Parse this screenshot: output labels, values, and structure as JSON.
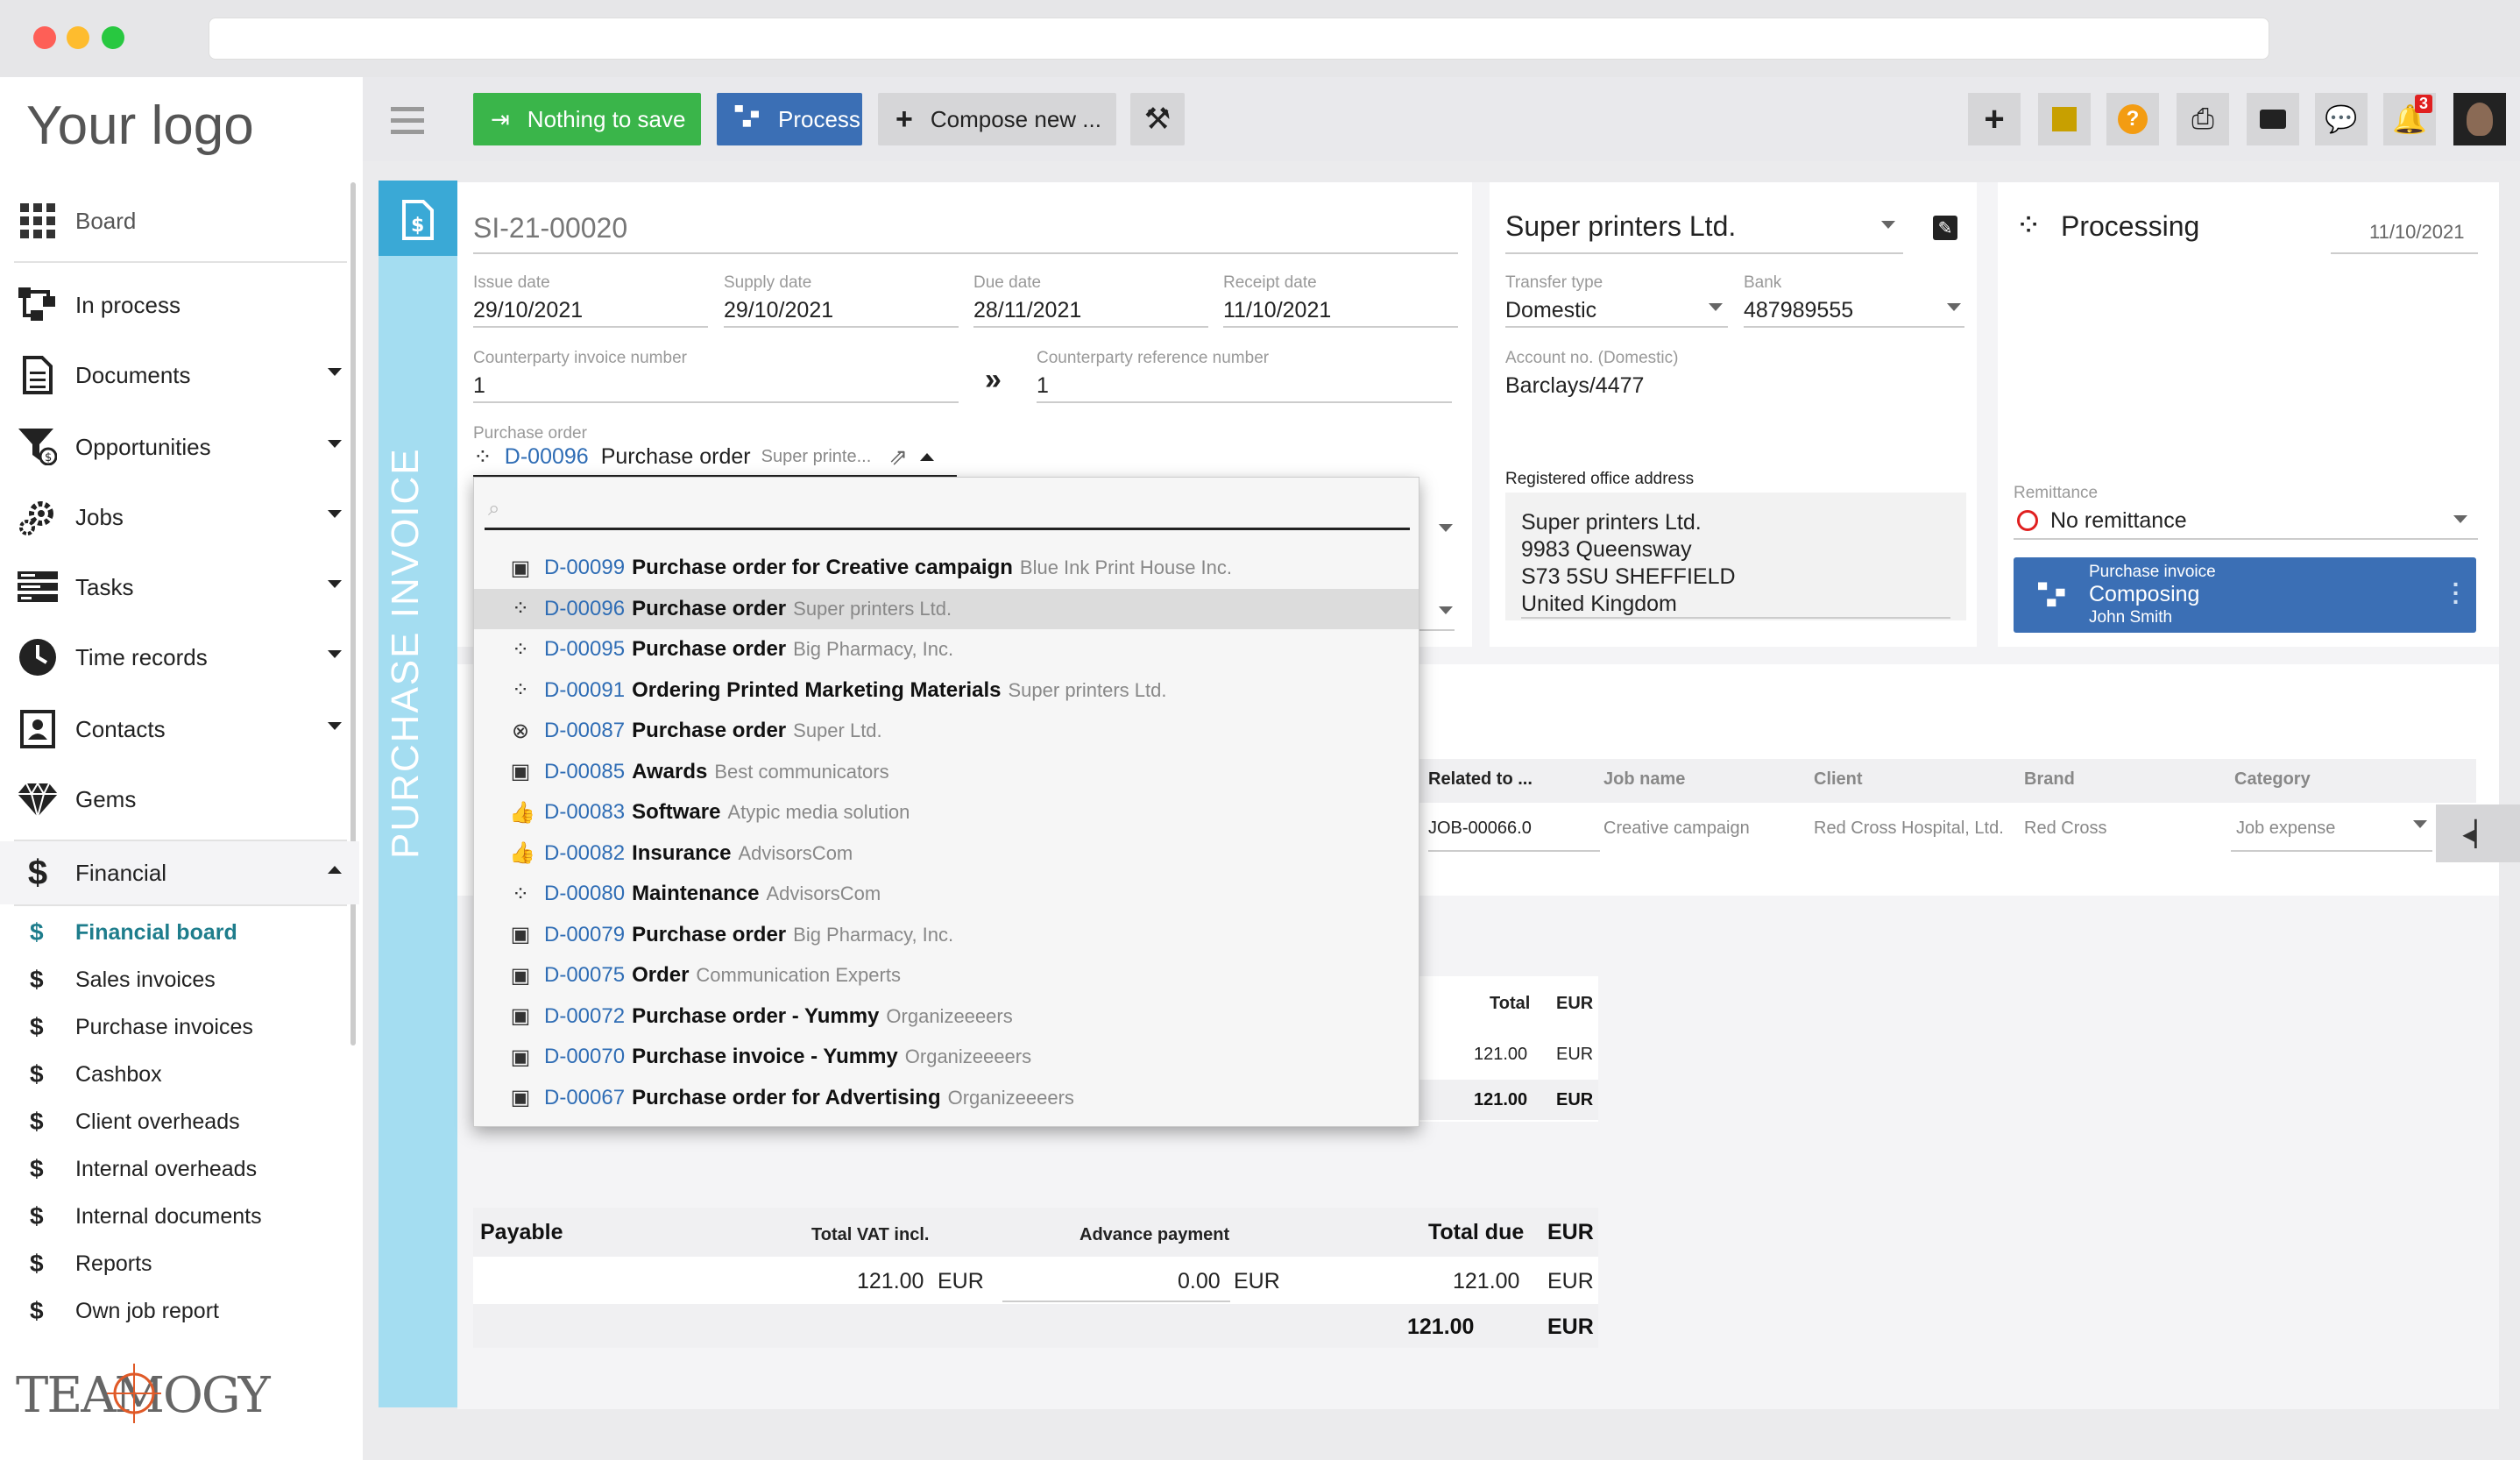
{
  "app": {
    "logo": "Your logo",
    "brand": "TEAMOGY"
  },
  "toolbar": {
    "nothing_to_save": "Nothing to save",
    "process": "Process",
    "compose": "Compose new ...",
    "notif_count": "3"
  },
  "sidebar": {
    "items": [
      {
        "label": "Board",
        "icon": "grid-icon"
      },
      {
        "label": "In process",
        "icon": "flow-icon"
      },
      {
        "label": "Documents",
        "icon": "document-icon"
      },
      {
        "label": "Opportunities",
        "icon": "funnel-icon"
      },
      {
        "label": "Jobs",
        "icon": "gear-icon"
      },
      {
        "label": "Tasks",
        "icon": "tasks-icon"
      },
      {
        "label": "Time records",
        "icon": "clock-icon"
      },
      {
        "label": "Contacts",
        "icon": "contact-icon"
      },
      {
        "label": "Gems",
        "icon": "gem-icon"
      },
      {
        "label": "Financial",
        "icon": "dollar-icon"
      }
    ],
    "sub": [
      "Financial board",
      "Sales invoices",
      "Purchase invoices",
      "Cashbox",
      "Client overheads",
      "Internal overheads",
      "Internal documents",
      "Reports",
      "Own job report"
    ]
  },
  "doc": {
    "type_label": "PURCHASE INVOICE",
    "number": "SI-21-00020",
    "issue_date_label": "Issue date",
    "issue_date": "29/10/2021",
    "supply_date_label": "Supply date",
    "supply_date": "29/10/2021",
    "due_date_label": "Due date",
    "due_date": "28/11/2021",
    "receipt_date_label": "Receipt date",
    "receipt_date": "11/10/2021",
    "cp_invoice_label": "Counterparty invoice number",
    "cp_invoice": "1",
    "cp_ref_label": "Counterparty reference number",
    "cp_ref": "1",
    "po_label": "Purchase order",
    "po_code": "D-00096",
    "po_name": "Purchase order",
    "po_cp": "Super printe..."
  },
  "supplier": {
    "name": "Super printers Ltd.",
    "transfer_label": "Transfer type",
    "transfer": "Domestic",
    "bank_label": "Bank",
    "bank": "487989555",
    "account_label": "Account no. (Domestic)",
    "account": "Barclays/4477",
    "address_label": "Registered office address",
    "address": [
      "Super printers Ltd.",
      "9983 Queensway",
      "S73 5SU SHEFFIELD",
      "United Kingdom"
    ]
  },
  "status": {
    "label": "Processing",
    "date": "11/10/2021",
    "remittance_label": "Remittance",
    "remittance": "No remittance",
    "wf_title": "Purchase invoice",
    "wf_state": "Composing",
    "wf_user": "John Smith"
  },
  "dropdown": [
    {
      "icon": "inbox-icon",
      "code": "D-00099",
      "name": "Purchase order for Creative campaign",
      "cp": "Blue Ink Print House Inc."
    },
    {
      "icon": "spinner-icon",
      "code": "D-00096",
      "name": "Purchase order",
      "cp": "Super printers Ltd.",
      "selected": true
    },
    {
      "icon": "spinner-icon",
      "code": "D-00095",
      "name": "Purchase order",
      "cp": "Big Pharmacy, Inc."
    },
    {
      "icon": "spinner-icon",
      "code": "D-00091",
      "name": "Ordering Printed Marketing Materials",
      "cp": "Super printers Ltd."
    },
    {
      "icon": "cancel-icon",
      "code": "D-00087",
      "name": "Purchase order",
      "cp": "Super Ltd."
    },
    {
      "icon": "inbox-icon",
      "code": "D-00085",
      "name": "Awards",
      "cp": "Best communicators"
    },
    {
      "icon": "thumbs-up-icon",
      "code": "D-00083",
      "name": "Software",
      "cp": "Atypic media solution"
    },
    {
      "icon": "thumbs-up-icon",
      "code": "D-00082",
      "name": "Insurance",
      "cp": "AdvisorsCom"
    },
    {
      "icon": "spinner-icon",
      "code": "D-00080",
      "name": "Maintenance",
      "cp": "AdvisorsCom"
    },
    {
      "icon": "inbox-icon",
      "code": "D-00079",
      "name": "Purchase order",
      "cp": "Big Pharmacy, Inc."
    },
    {
      "icon": "inbox-icon",
      "code": "D-00075",
      "name": "Order",
      "cp": "Communication Experts"
    },
    {
      "icon": "inbox-icon",
      "code": "D-00072",
      "name": "Purchase order - Yummy",
      "cp": "Organizeeeers"
    },
    {
      "icon": "inbox-icon",
      "code": "D-00070",
      "name": "Purchase invoice - Yummy",
      "cp": "Organizeeeers"
    },
    {
      "icon": "inbox-icon",
      "code": "D-00067",
      "name": "Purchase order for Advertising",
      "cp": "Organizeeeers"
    }
  ],
  "items_table": {
    "headers": [
      "Related to ...",
      "Job name",
      "Client",
      "Brand",
      "Category"
    ],
    "row": [
      "JOB-00066.0",
      "Creative campaign",
      "Red Cross Hospital, Ltd.",
      "Red Cross",
      "Job expense"
    ]
  },
  "totals_small": {
    "total_label": "Total",
    "currency": "EUR",
    "row1": "121.00",
    "row2": "121.00"
  },
  "summary": {
    "payable": "Payable",
    "vat_label": "Total VAT incl.",
    "advance_label": "Advance payment",
    "due_label": "Total due",
    "currency": "EUR",
    "vat": "121.00",
    "advance": "0.00",
    "due": "121.00",
    "grand": "121.00"
  }
}
